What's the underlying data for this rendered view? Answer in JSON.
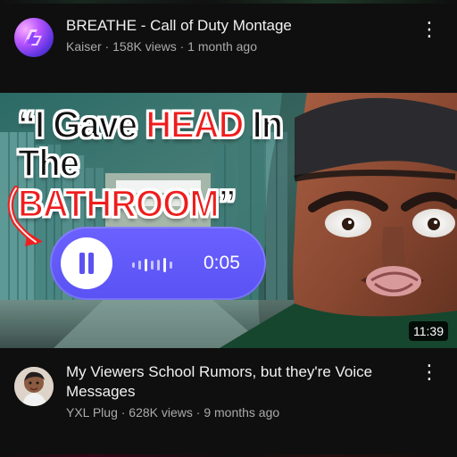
{
  "feed": {
    "videos": [
      {
        "title": "BREATHE - Call of Duty Montage",
        "channel": "Kaiser",
        "views": "158K views",
        "age": "1 month ago",
        "subtitle": "Kaiser · 158K views · 1 month ago",
        "avatar_icon": "gaming-logo-icon",
        "menu_icon": "more-vertical-icon"
      },
      {
        "thumbnail": {
          "headline_line_1_prefix": "“I Gave ",
          "headline_line_1_highlight": "HEAD",
          "headline_line_1_suffix": " In",
          "headline_line_2_prefix": "The ",
          "headline_line_2_highlight": "BATHROOM",
          "headline_line_2_suffix": "”",
          "voice_time": "0:05",
          "duration": "11:39",
          "accent_color": "#5b52f3",
          "highlight_color": "#ee1d1d",
          "play_icon": "pause-icon"
        },
        "title": "My Viewers School Rumors, but they're Voice Messages",
        "channel": "YXL Plug",
        "views": "628K views",
        "age": "9 months ago",
        "subtitle": "YXL Plug · 628K views · 9 months ago",
        "avatar_icon": "creator-avatar-icon",
        "menu_icon": "more-vertical-icon"
      }
    ]
  }
}
